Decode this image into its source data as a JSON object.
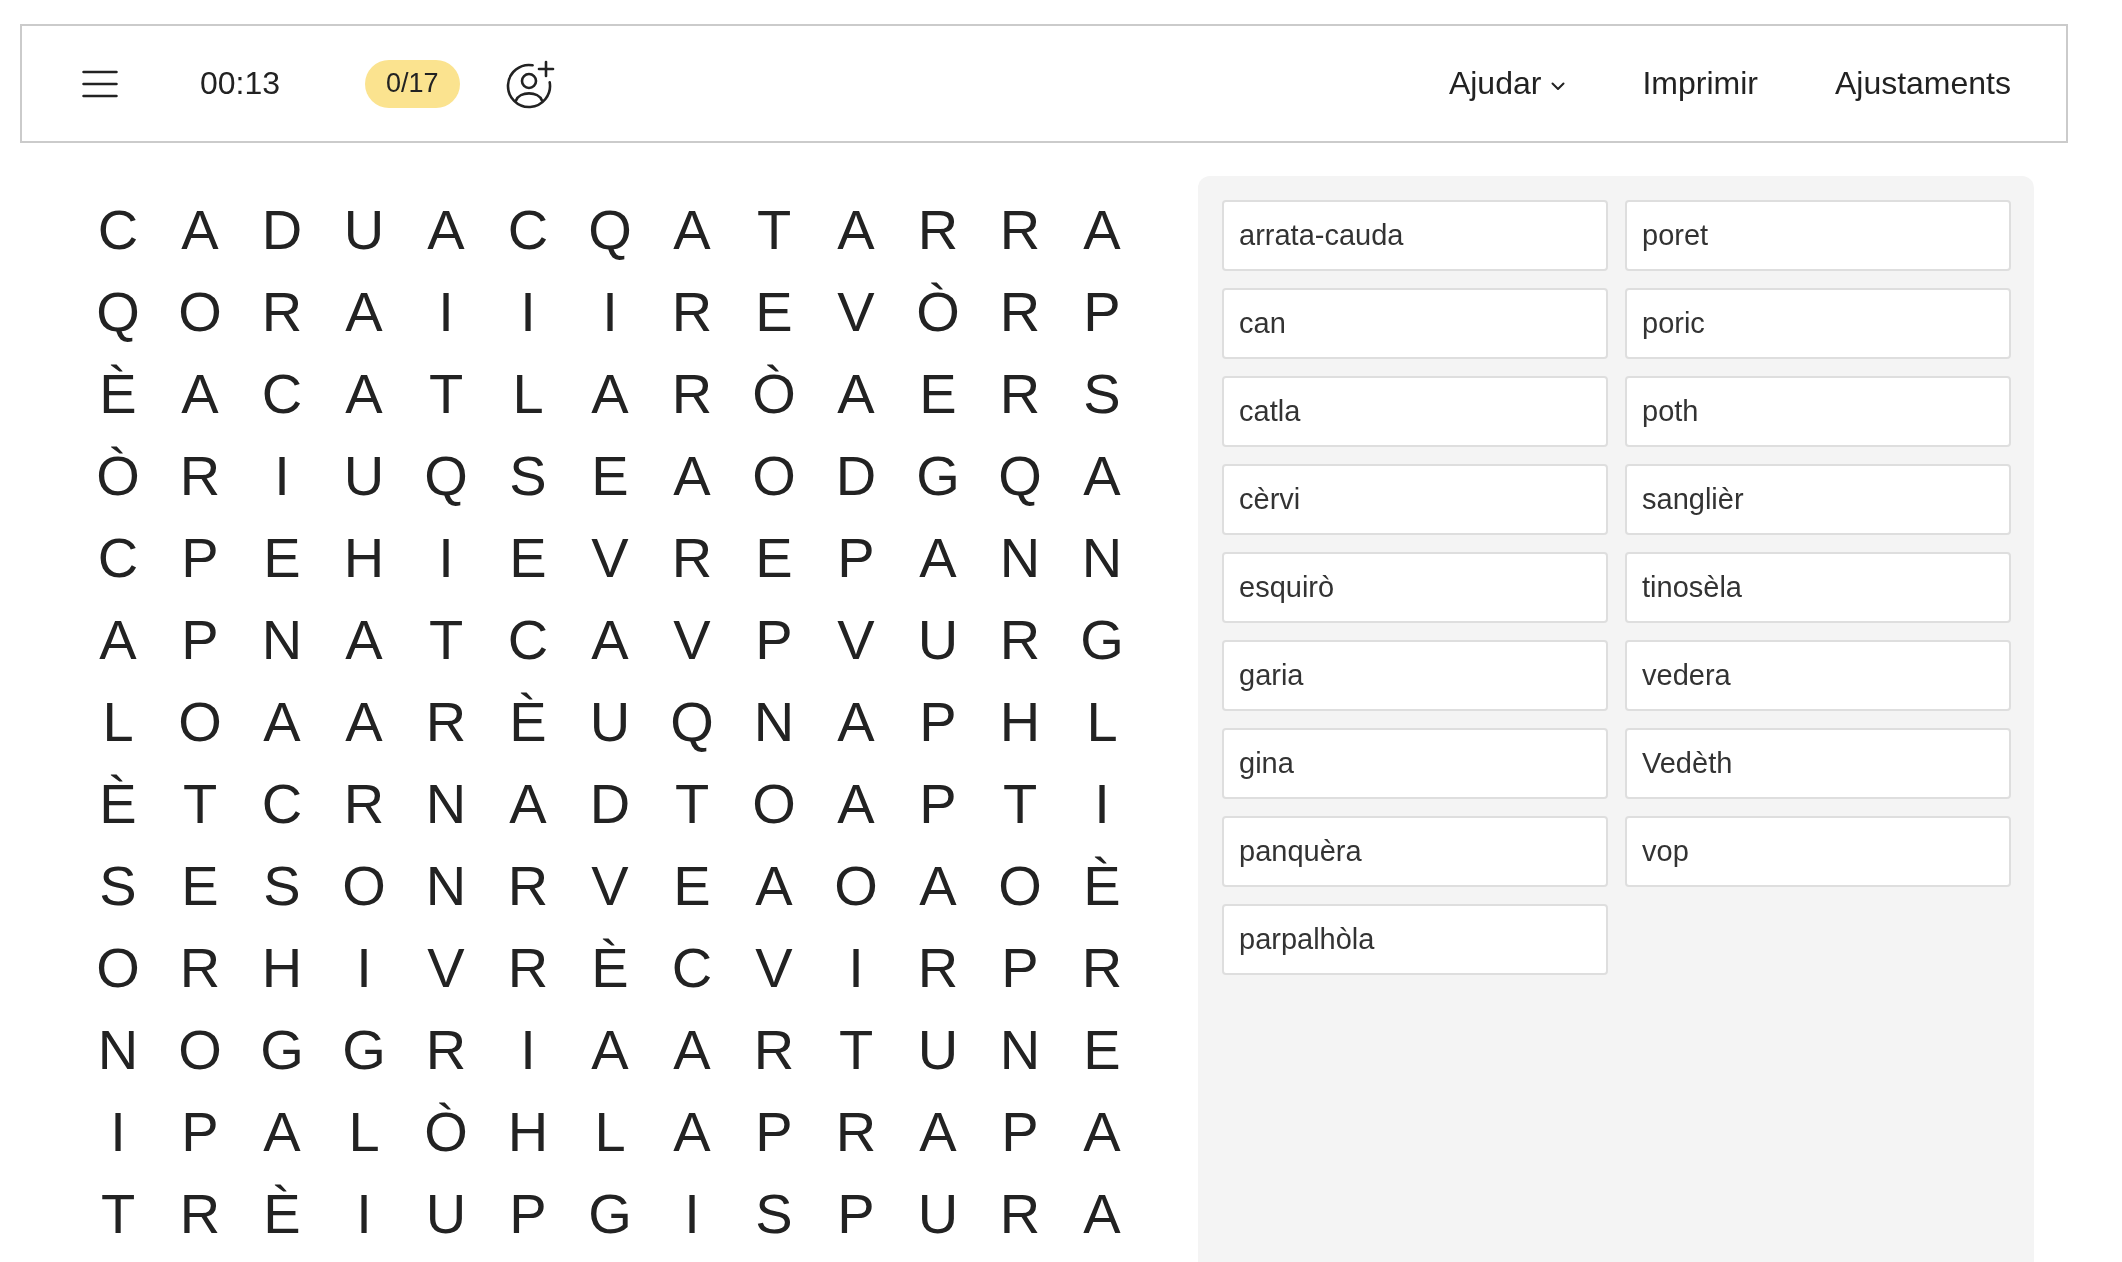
{
  "toolbar": {
    "timer": "00:13",
    "progress_badge": "0/17",
    "menu": [
      {
        "label": "Ajudar",
        "kind": "dropdown"
      },
      {
        "label": "Imprimir",
        "kind": "link"
      },
      {
        "label": "Ajustaments",
        "kind": "link"
      }
    ]
  },
  "grid": {
    "rows": [
      [
        "C",
        "A",
        "D",
        "U",
        "A",
        "C",
        "Q",
        "A",
        "T",
        "A",
        "R",
        "R",
        "A"
      ],
      [
        "Q",
        "O",
        "R",
        "A",
        "I",
        "I",
        "I",
        "R",
        "E",
        "V",
        "Ò",
        "R",
        "P"
      ],
      [
        "È",
        "A",
        "C",
        "A",
        "T",
        "L",
        "A",
        "R",
        "Ò",
        "A",
        "E",
        "R",
        "S"
      ],
      [
        "Ò",
        "R",
        "I",
        "U",
        "Q",
        "S",
        "E",
        "A",
        "O",
        "D",
        "G",
        "Q",
        "A"
      ],
      [
        "C",
        "P",
        "E",
        "H",
        "I",
        "E",
        "V",
        "R",
        "E",
        "P",
        "A",
        "N",
        "N"
      ],
      [
        "A",
        "P",
        "N",
        "A",
        "T",
        "C",
        "A",
        "V",
        "P",
        "V",
        "U",
        "R",
        "G"
      ],
      [
        "L",
        "O",
        "A",
        "A",
        "R",
        "È",
        "U",
        "Q",
        "N",
        "A",
        "P",
        "H",
        "L"
      ],
      [
        "È",
        "T",
        "C",
        "R",
        "N",
        "A",
        "D",
        "T",
        "O",
        "A",
        "P",
        "T",
        "I"
      ],
      [
        "S",
        "E",
        "S",
        "O",
        "N",
        "R",
        "V",
        "E",
        "A",
        "O",
        "A",
        "O",
        "È"
      ],
      [
        "O",
        "R",
        "H",
        "I",
        "V",
        "R",
        "È",
        "C",
        "V",
        "I",
        "R",
        "P",
        "R"
      ],
      [
        "N",
        "O",
        "G",
        "G",
        "R",
        "I",
        "A",
        "A",
        "R",
        "T",
        "U",
        "N",
        "E"
      ],
      [
        "I",
        "P",
        "A",
        "L",
        "Ò",
        "H",
        "L",
        "A",
        "P",
        "R",
        "A",
        "P",
        "A"
      ],
      [
        "T",
        "R",
        "È",
        "I",
        "U",
        "P",
        "G",
        "I",
        "S",
        "P",
        "U",
        "R",
        "A"
      ]
    ]
  },
  "words": [
    "arrata-cauda",
    "can",
    "catla",
    "cèrvi",
    "esquirò",
    "garia",
    "gina",
    "panquèra",
    "parpalhòla",
    "poret",
    "poric",
    "poth",
    "sanglièr",
    "tinosèla",
    "vedera",
    "Vedèth",
    "vop"
  ]
}
